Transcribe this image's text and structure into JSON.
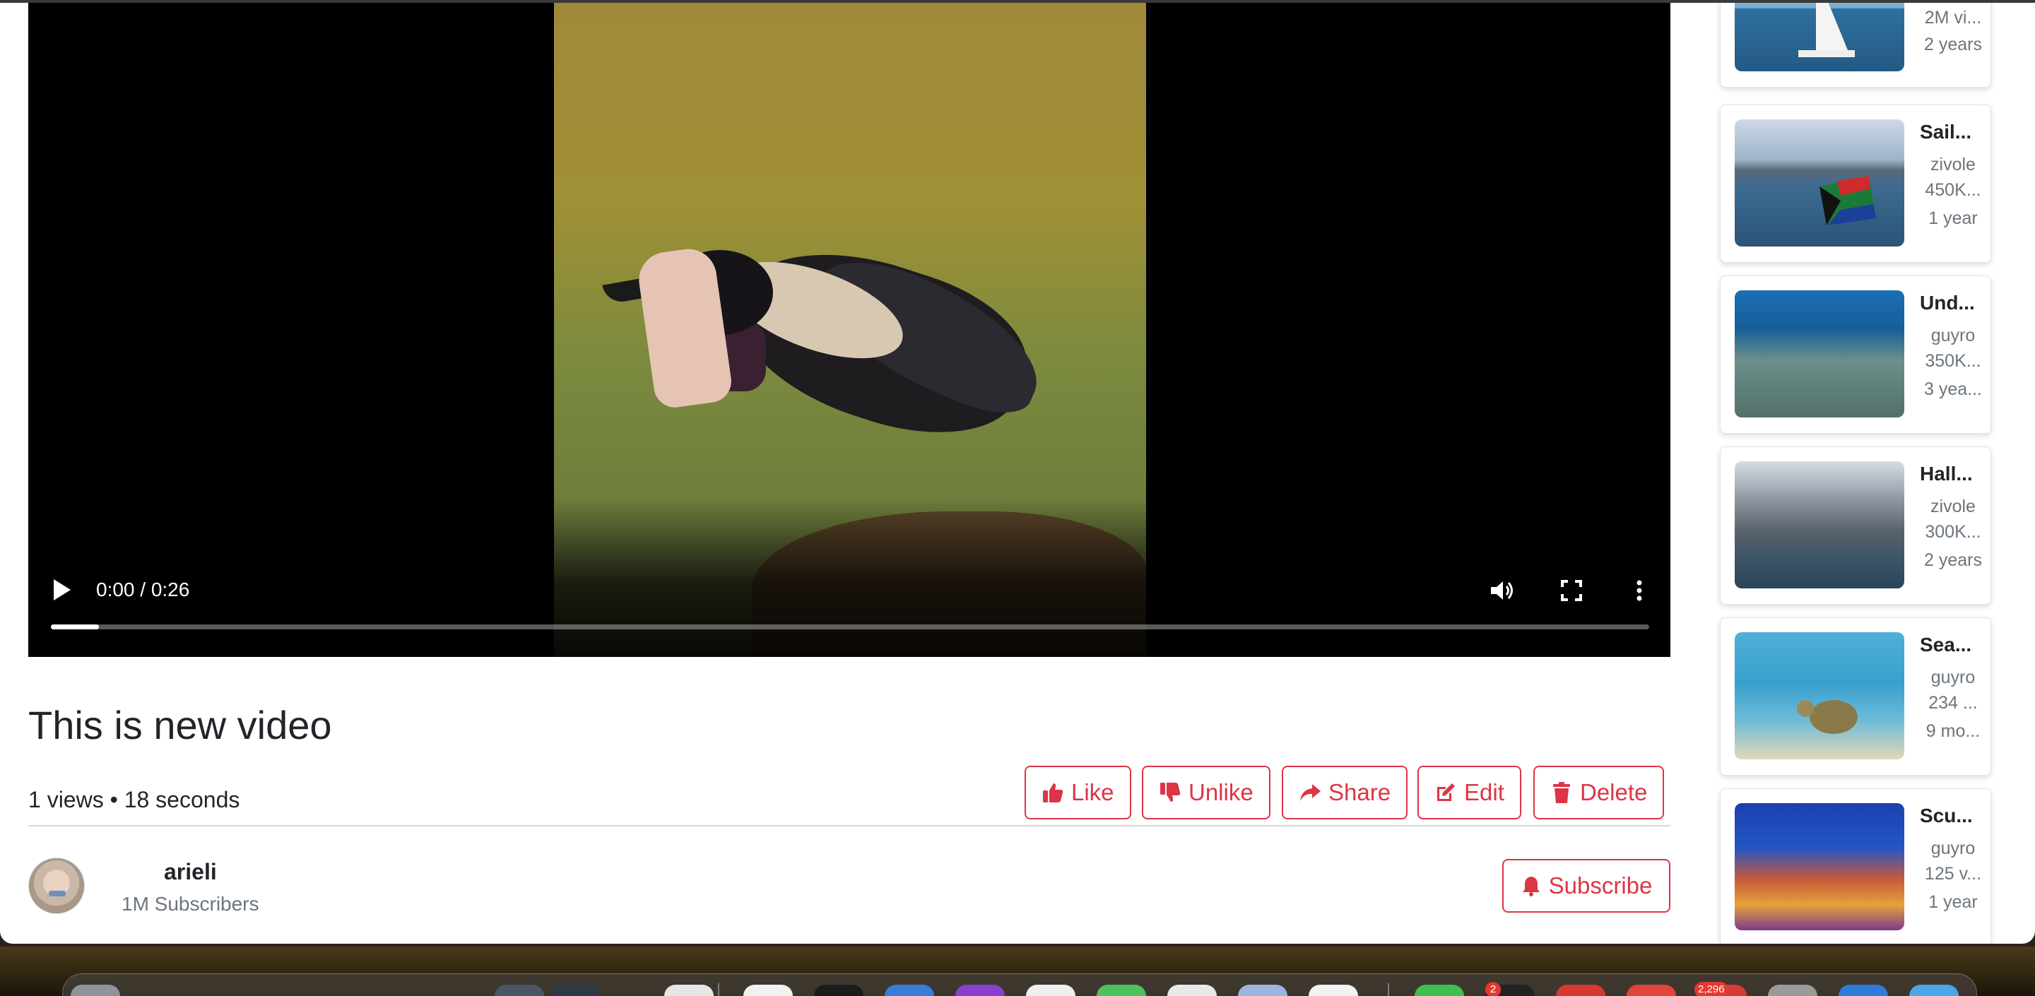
{
  "video": {
    "time_display": "0:00 / 0:26",
    "progress": 0.03,
    "title": "This is new video",
    "stats": "1 views • 18 seconds"
  },
  "actions": {
    "like": "Like",
    "unlike": "Unlike",
    "share": "Share",
    "edit": "Edit",
    "delete": "Delete"
  },
  "channel": {
    "name": "arieli",
    "subscribers": "1M Subscribers",
    "subscribe_label": "Subscribe"
  },
  "related": [
    {
      "title": "",
      "channel": "",
      "views": "2M vi...",
      "age": "2 years"
    },
    {
      "title": "Sail...",
      "channel": "zivole",
      "views": "450K...",
      "age": "1 year"
    },
    {
      "title": "Und...",
      "channel": "guyro",
      "views": "350K...",
      "age": "3 yea..."
    },
    {
      "title": "Hall...",
      "channel": "zivole",
      "views": "300K...",
      "age": "2 years"
    },
    {
      "title": "Sea...",
      "channel": "guyro",
      "views": "234 ...",
      "age": "9 mo..."
    },
    {
      "title": "Scu...",
      "channel": "guyro",
      "views": "125 v...",
      "age": "1 year"
    }
  ],
  "dock": {
    "badges": [
      "2",
      "2,296"
    ]
  },
  "colors": {
    "accent": "#dc3545",
    "text": "#212529",
    "muted": "#6c757d"
  },
  "icons": {
    "play": "play-icon",
    "volume": "volume-icon",
    "fullscreen": "fullscreen-icon",
    "more": "more-vertical-icon",
    "like": "thumbs-up-icon",
    "unlike": "thumbs-down-icon",
    "share": "share-arrow-icon",
    "edit": "edit-icon",
    "delete": "trash-icon",
    "subscribe": "bell-icon"
  }
}
